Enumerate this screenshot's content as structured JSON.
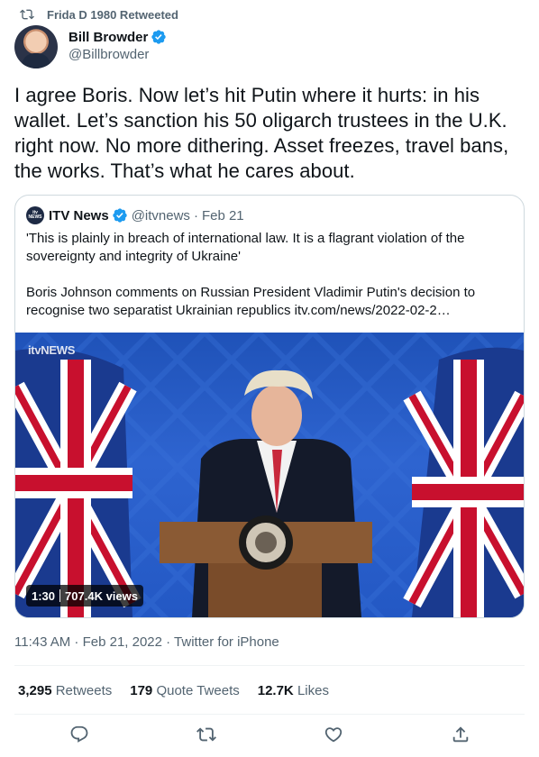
{
  "retweet_context": {
    "text": "Frida D 1980 Retweeted",
    "icon": "retweet-icon"
  },
  "author": {
    "name": "Bill Browder",
    "handle": "@Billbrowder",
    "verified": true
  },
  "tweet": {
    "text": "I agree Boris. Now let’s hit Putin where it hurts: in his wallet. Let’s sanction his 50 oligarch trustees in the U.K. right now. No more dithering. Asset freezes, travel bans, the works. That’s what he cares about."
  },
  "quoted": {
    "name": "ITV News",
    "handle": "@itvnews",
    "dot": "·",
    "date": "Feb 21",
    "logo_text": "itv NEWS",
    "paragraph1": "'This is plainly in breach of international law. It is a flagrant violation of the sovereignty and integrity of Ukraine'",
    "paragraph2": "Boris Johnson comments on Russian President Vladimir Putin's decision to recognise two separatist Ukrainian republics itv.com/news/2022-02-2…",
    "video": {
      "watermark": "itvNEWS",
      "duration": "1:30",
      "views": "707.4K views"
    }
  },
  "meta": {
    "timestamp": "11:43 AM · Feb 21, 2022 · Twitter for iPhone"
  },
  "stats": {
    "retweets_count": "3,295",
    "retweets_label": "Retweets",
    "quotes_count": "179",
    "quotes_label": "Quote Tweets",
    "likes_count": "12.7K",
    "likes_label": "Likes"
  },
  "actions": [
    "reply-icon",
    "retweet-icon",
    "like-icon",
    "share-icon"
  ],
  "colors": {
    "accent": "#1d9bf0",
    "text": "#0f1419",
    "secondary": "#536471",
    "border": "#cfd9de"
  }
}
